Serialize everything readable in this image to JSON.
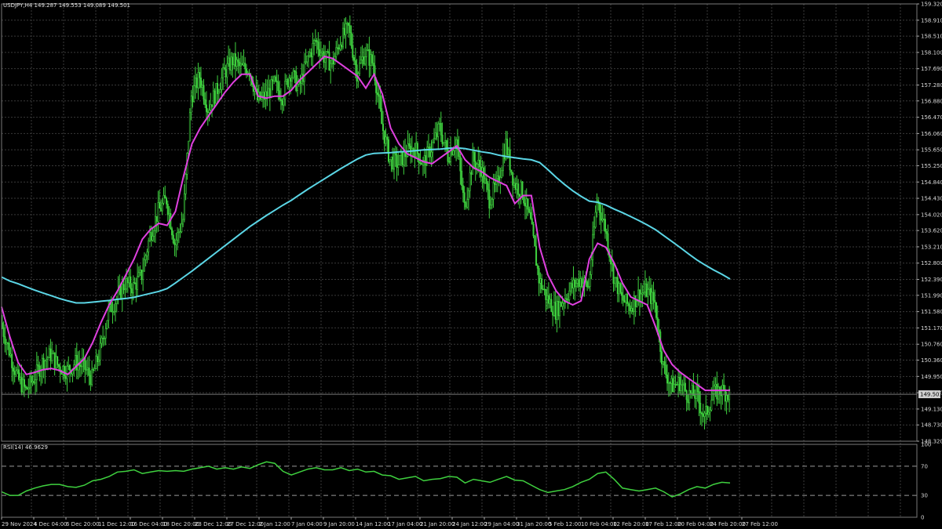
{
  "header": {
    "main_label": "USDJPY,H4  149.287 149.553 149.089 149.501",
    "rsi_label": "RSI(14) 46.9629"
  },
  "colors": {
    "background": "#000000",
    "grid": "#3a3a3a",
    "candles": "#3fd13f",
    "ma_fast": "#e040e0",
    "ma_slow": "#5bd6e6",
    "rsi_line": "#3fd13f",
    "axis_text": "#d8d8d8",
    "price_marker_bg": "#d0d0d0"
  },
  "current_price_label": "149.501",
  "chart_data": [
    {
      "type": "line",
      "panel": "price",
      "y_scale": "linear",
      "ylim": [
        148.32,
        159.32
      ],
      "grid": true,
      "y_ticks": [
        "159.320",
        "158.910",
        "158.510",
        "158.100",
        "157.690",
        "157.280",
        "156.880",
        "156.470",
        "156.060",
        "155.650",
        "155.250",
        "154.840",
        "154.430",
        "154.020",
        "153.620",
        "153.210",
        "152.800",
        "152.390",
        "151.990",
        "151.580",
        "151.170",
        "150.760",
        "150.360",
        "149.950",
        "149.540",
        "149.130",
        "148.730",
        "148.320"
      ],
      "x_ticks": [
        "29 Nov 2024",
        "4 Dec 04:00",
        "6 Dec 20:00",
        "11 Dec 12:00",
        "16 Dec 04:00",
        "18 Dec 20:00",
        "23 Dec 12:00",
        "27 Dec 12:00",
        "2 Jan 12:00",
        "7 Jan 04:00",
        "9 Jan 20:00",
        "14 Jan 12:00",
        "17 Jan 04:00",
        "21 Jan 20:00",
        "24 Jan 12:00",
        "29 Jan 04:00",
        "31 Jan 20:00",
        "5 Feb 12:00",
        "10 Feb 04:00",
        "12 Feb 20:00",
        "17 Feb 12:00",
        "20 Feb 04:00",
        "24 Feb 20:00",
        "27 Feb 12:00"
      ],
      "last_price": 149.501,
      "series": [
        {
          "role": "price",
          "values": [
            151.3,
            150.6,
            149.9,
            149.6,
            149.9,
            150.3,
            150.5,
            150.2,
            150.1,
            150.3,
            150.2,
            149.9,
            150.6,
            151.6,
            151.9,
            152.3,
            152.2,
            152.5,
            153.5,
            154.1,
            154.4,
            153.3,
            153.9,
            157.0,
            157.5,
            156.7,
            157.1,
            157.6,
            157.9,
            157.7,
            157.7,
            156.9,
            157.0,
            157.3,
            157.0,
            157.6,
            157.2,
            157.9,
            158.4,
            158.0,
            157.8,
            158.4,
            158.7,
            157.6,
            158.1,
            157.8,
            156.3,
            155.4,
            155.3,
            155.6,
            155.7,
            155.3,
            155.7,
            156.2,
            155.5,
            155.9,
            154.2,
            155.4,
            155.2,
            154.4,
            154.8,
            155.8,
            154.8,
            154.6,
            153.8,
            152.4,
            151.9,
            151.6,
            151.9,
            152.2,
            152.4,
            152.2,
            154.4,
            153.7,
            152.5,
            151.9,
            151.7,
            152.0,
            152.1,
            151.8,
            150.2,
            149.7,
            149.8,
            149.5,
            149.5,
            148.9,
            149.5,
            149.6,
            149.5
          ]
        },
        {
          "role": "ma_fast",
          "values": [
            151.7,
            150.95,
            150.3,
            150.0,
            150.05,
            150.12,
            150.15,
            150.1,
            150.0,
            150.2,
            150.4,
            150.8,
            151.3,
            151.75,
            152.1,
            152.5,
            152.9,
            153.4,
            153.65,
            153.8,
            153.75,
            154.1,
            155.0,
            155.8,
            156.2,
            156.5,
            156.8,
            157.1,
            157.35,
            157.55,
            157.55,
            157.0,
            156.95,
            157.0,
            157.0,
            157.15,
            157.4,
            157.6,
            157.8,
            158.0,
            157.95,
            157.8,
            157.65,
            157.5,
            157.2,
            157.55,
            157.05,
            156.2,
            155.8,
            155.55,
            155.45,
            155.35,
            155.3,
            155.45,
            155.6,
            155.75,
            155.4,
            155.2,
            155.1,
            154.95,
            154.85,
            154.75,
            154.3,
            154.5,
            154.5,
            153.2,
            152.5,
            152.1,
            151.85,
            151.75,
            151.85,
            152.9,
            153.3,
            153.2,
            152.8,
            152.3,
            151.95,
            151.85,
            151.75,
            151.2,
            150.6,
            150.25,
            150.05,
            149.9,
            149.75,
            149.6,
            149.6,
            149.6,
            149.6
          ]
        },
        {
          "role": "ma_slow",
          "values": [
            152.45,
            152.35,
            152.28,
            152.2,
            152.12,
            152.05,
            151.98,
            151.91,
            151.85,
            151.8,
            151.8,
            151.82,
            151.84,
            151.86,
            151.89,
            151.91,
            151.94,
            151.99,
            152.04,
            152.09,
            152.16,
            152.3,
            152.45,
            152.6,
            152.76,
            152.92,
            153.08,
            153.24,
            153.4,
            153.56,
            153.72,
            153.86,
            154.0,
            154.13,
            154.26,
            154.38,
            154.52,
            154.66,
            154.79,
            154.92,
            155.05,
            155.18,
            155.3,
            155.42,
            155.52,
            155.56,
            155.57,
            155.58,
            155.6,
            155.61,
            155.63,
            155.65,
            155.66,
            155.67,
            155.69,
            155.7,
            155.68,
            155.64,
            155.6,
            155.57,
            155.52,
            155.48,
            155.45,
            155.42,
            155.4,
            155.33,
            155.15,
            154.96,
            154.78,
            154.62,
            154.48,
            154.36,
            154.33,
            154.26,
            154.16,
            154.07,
            153.97,
            153.87,
            153.76,
            153.64,
            153.49,
            153.34,
            153.19,
            153.03,
            152.88,
            152.75,
            152.63,
            152.52,
            152.4
          ]
        }
      ]
    },
    {
      "type": "line",
      "panel": "rsi",
      "ylim": [
        0,
        100
      ],
      "y_ticks": [
        "100",
        "70",
        "30",
        "0"
      ],
      "levels": [
        70,
        30
      ],
      "series": [
        {
          "role": "rsi",
          "values": [
            35,
            30,
            30,
            36,
            40,
            43,
            45,
            45,
            42,
            41,
            44,
            50,
            52,
            56,
            62,
            63,
            65,
            60,
            62,
            64,
            63,
            64,
            63,
            66,
            68,
            70,
            66,
            68,
            66,
            69,
            67,
            72,
            76,
            74,
            63,
            58,
            62,
            66,
            68,
            65,
            65,
            68,
            64,
            66,
            62,
            63,
            58,
            57,
            52,
            54,
            56,
            50,
            52,
            53,
            56,
            55,
            47,
            52,
            50,
            48,
            52,
            56,
            51,
            50,
            44,
            38,
            34,
            36,
            38,
            42,
            48,
            52,
            60,
            62,
            52,
            40,
            38,
            36,
            38,
            40,
            35,
            28,
            32,
            38,
            42,
            40,
            45,
            48,
            47
          ]
        }
      ]
    }
  ]
}
